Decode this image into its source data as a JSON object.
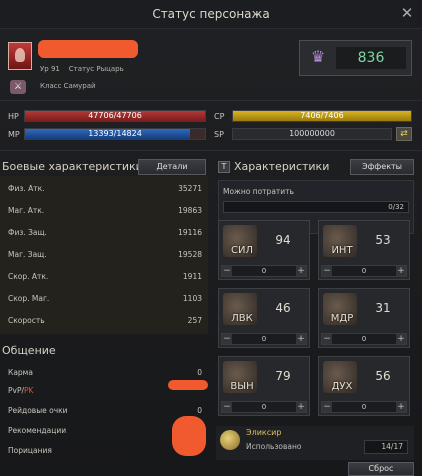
{
  "window": {
    "title": "Статус персонажа",
    "close": "✕"
  },
  "profile": {
    "level_label": "Ур",
    "level_value": "91",
    "status_label": "Статус",
    "status_value": "Рыцарь",
    "class_label": "Класс",
    "class_value": "Самурай",
    "combat_power": "836"
  },
  "bars": {
    "hp": {
      "label": "HP",
      "text": "47706/47706",
      "fill": 1.0
    },
    "mp": {
      "label": "MP",
      "text": "13393/14824",
      "fill": 0.9
    },
    "cp": {
      "label": "CP",
      "text": "7406/7406",
      "fill": 1.0
    },
    "sp": {
      "label": "SP",
      "text": "100000000"
    }
  },
  "combat": {
    "title": "Боевые характеристики",
    "details_button": "Детали",
    "rows": [
      {
        "label": "Физ. Атк.",
        "value": "35271"
      },
      {
        "label": "Маг. Атк.",
        "value": "19863"
      },
      {
        "label": "Физ. Защ.",
        "value": "19116"
      },
      {
        "label": "Маг. Защ.",
        "value": "19528"
      },
      {
        "label": "Скор. Атк.",
        "value": "1911"
      },
      {
        "label": "Скор. Маг.",
        "value": "1103"
      },
      {
        "label": "Скорость",
        "value": "257"
      }
    ]
  },
  "characteristics": {
    "title": "Характеристики",
    "effects_button": "Эффекты",
    "spend_label": "Можно потратить",
    "points": "0/32",
    "stats": [
      {
        "abbr": "СИЛ",
        "value": "94",
        "alloc": "0"
      },
      {
        "abbr": "ИНТ",
        "value": "53",
        "alloc": "0"
      },
      {
        "abbr": "ЛВК",
        "value": "46",
        "alloc": "0"
      },
      {
        "abbr": "МДР",
        "value": "31",
        "alloc": "0"
      },
      {
        "abbr": "ВЫН",
        "value": "79",
        "alloc": "0"
      },
      {
        "abbr": "ДУХ",
        "value": "56",
        "alloc": "0"
      }
    ],
    "minus": "−",
    "plus": "+"
  },
  "social": {
    "title": "Общение",
    "karma_label": "Карма",
    "karma_value": "0",
    "pvp_label": "PvP/",
    "pk_label": "PK",
    "raid_label": "Рейдовые очки",
    "raid_value": "0",
    "recommend_label": "Рекомендации",
    "blame_label": "Порицания"
  },
  "elixir": {
    "name": "Эликсир",
    "used_label": "Использовано",
    "used_value": "14/17"
  },
  "reset_button": "Сброс",
  "colors": {
    "accent": "#e0c060",
    "cp_value": "#7fd7a0",
    "pk": "#e2533f"
  }
}
